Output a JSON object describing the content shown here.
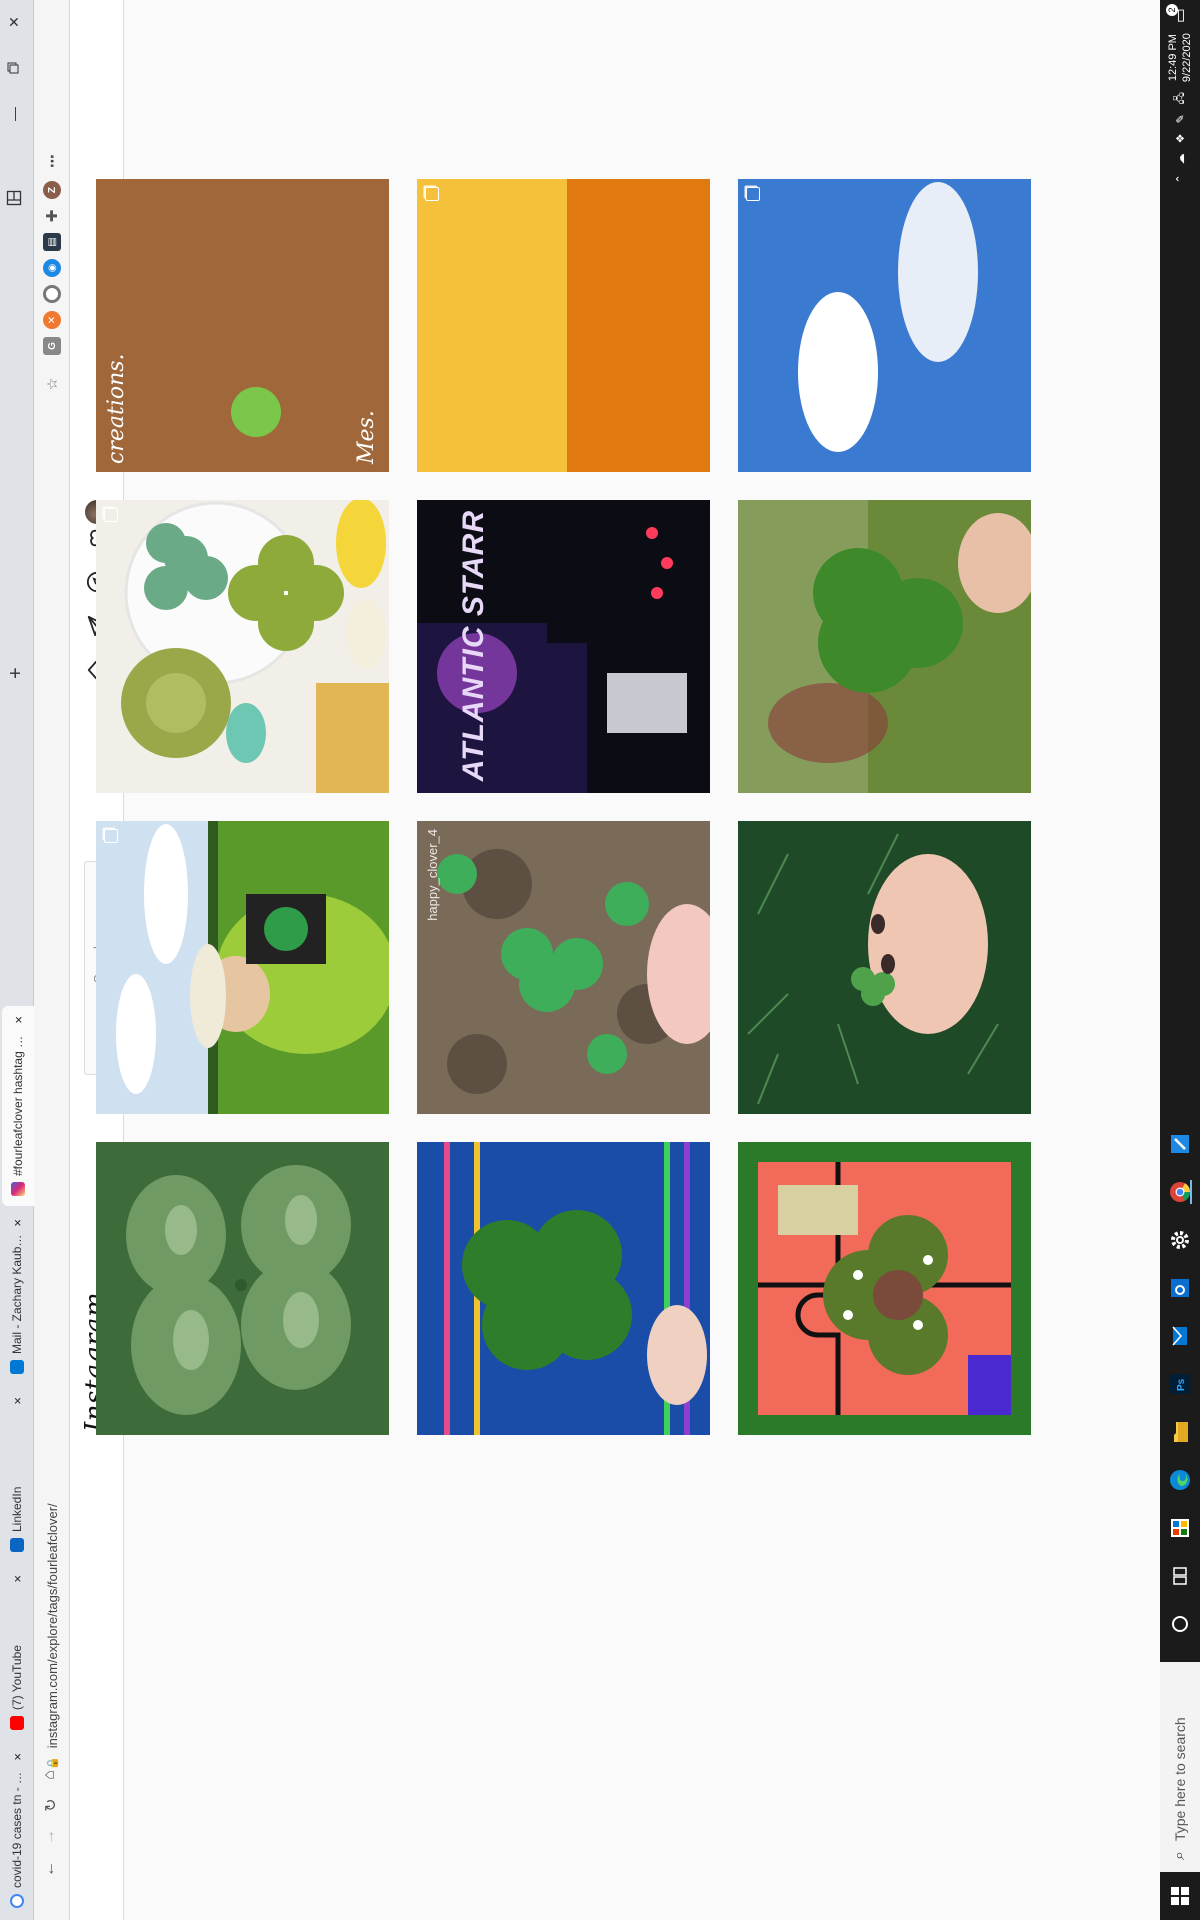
{
  "browser": {
    "tabs": [
      {
        "label": "covid-19 cases tn - Google Search",
        "favicon_color": "#4285f4",
        "favicon": "google-icon"
      },
      {
        "label": "(7) YouTube",
        "favicon_color": "#ff0000",
        "favicon": "youtube-icon"
      },
      {
        "label": "LinkedIn",
        "favicon_color": "#0a66c2",
        "favicon": "linkedin-icon"
      },
      {
        "label": "Mail - Zachary Kauble - Outlook",
        "favicon_color": "#0078d4",
        "favicon": "outlook-icon"
      },
      {
        "label": "#fourleafclover hashtag on Insta",
        "favicon_color": "#e1306c",
        "favicon": "instagram-icon"
      }
    ],
    "new_tab_label": "+",
    "close_glyph": "×",
    "url": "instagram.com/explore/tags/fourleafclover/"
  },
  "instagram": {
    "logo_text": "Instagram",
    "search_placeholder": "Search"
  },
  "posts": [
    {
      "row": 0,
      "col": 0,
      "scene": "clover-field",
      "multi": false
    },
    {
      "row": 0,
      "col": 1,
      "scene": "child-hat",
      "multi": true
    },
    {
      "row": 0,
      "col": 2,
      "scene": "crochet",
      "multi": true
    },
    {
      "row": 0,
      "col": 3,
      "scene": "creations",
      "multi": false,
      "overlay": "creations.",
      "overlay2": "Mes."
    },
    {
      "row": 1,
      "col": 0,
      "scene": "blue-fabric",
      "multi": false
    },
    {
      "row": 1,
      "col": 1,
      "scene": "clover-dirt",
      "multi": false,
      "overlay": "happy_clover_4"
    },
    {
      "row": 1,
      "col": 2,
      "scene": "album",
      "multi": false,
      "overlay": "ATLANTIC STARR"
    },
    {
      "row": 1,
      "col": 3,
      "scene": "orange",
      "multi": true
    },
    {
      "row": 2,
      "col": 0,
      "scene": "puzzle",
      "multi": false
    },
    {
      "row": 2,
      "col": 1,
      "scene": "pine-hand",
      "multi": false
    },
    {
      "row": 2,
      "col": 2,
      "scene": "blur-hand",
      "multi": false
    },
    {
      "row": 2,
      "col": 3,
      "scene": "sky",
      "multi": true
    }
  ],
  "taskbar": {
    "search_placeholder": "Type here to search",
    "time": "12:49 PM",
    "date": "9/22/2020",
    "notification_count": "2"
  }
}
